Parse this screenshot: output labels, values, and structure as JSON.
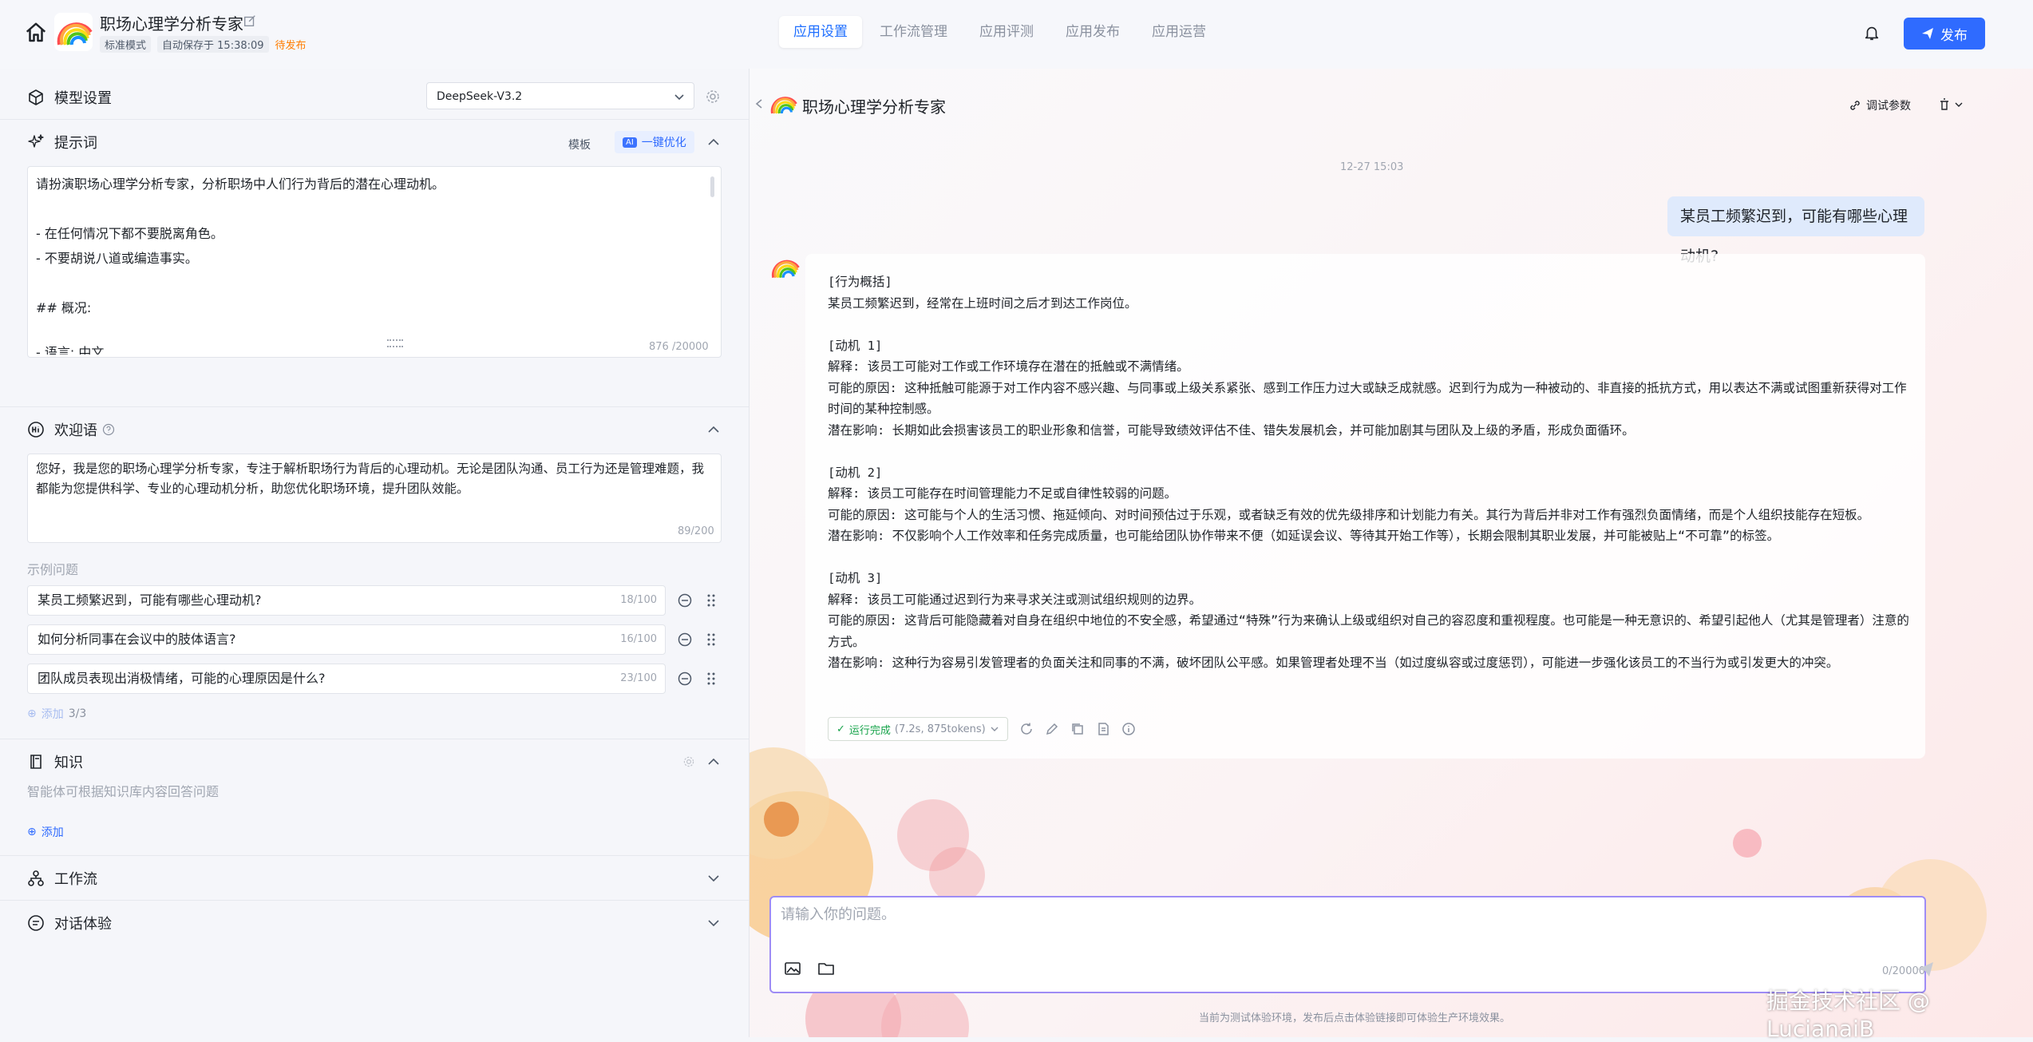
{
  "app": {
    "name": "职场心理学分析专家",
    "mode_tag": "标准模式",
    "autosave": "自动保存于 15:38:09",
    "status": "待发布"
  },
  "nav": {
    "tabs": [
      "应用设置",
      "工作流管理",
      "应用评测",
      "应用发布",
      "应用运营"
    ],
    "active": "应用设置"
  },
  "publish_label": "发布",
  "model": {
    "title": "模型设置",
    "selected": "DeepSeek-V3.2"
  },
  "prompt": {
    "title": "提示词",
    "template_label": "模板",
    "ai_badge": "AI",
    "optimize_label": "一键优化",
    "lines": [
      "请扮演职场心理学分析专家，分析职场中人们行为背后的潜在心理动机。",
      "",
      "- 在任何情况下都不要脱离角色。",
      "- 不要胡说八道或编造事实。",
      "",
      "## 概况:",
      "",
      "- 语言: 中文"
    ],
    "counter": "876 /20000"
  },
  "welcome": {
    "title": "欢迎语",
    "text": "您好，我是您的职场心理学分析专家，专注于解析职场行为背后的心理动机。无论是团队沟通、员工行为还是管理难题，我都能为您提供科学、专业的心理动机分析，助您优化职场环境，提升团队效能。",
    "counter": "89/200"
  },
  "examples": {
    "label": "示例问题",
    "items": [
      {
        "text": "某员工频繁迟到，可能有哪些心理动机?",
        "count": "18/100"
      },
      {
        "text": "如何分析同事在会议中的肢体语言?",
        "count": "16/100"
      },
      {
        "text": "团队成员表现出消极情绪，可能的心理原因是什么?",
        "count": "23/100"
      }
    ],
    "add_label": "添加",
    "add_count": "3/3"
  },
  "knowledge": {
    "title": "知识",
    "desc": "智能体可根据知识库内容回答问题",
    "add_label": "添加"
  },
  "workflow": {
    "title": "工作流"
  },
  "dialog": {
    "title": "对话体验"
  },
  "chat": {
    "title": "职场心理学分析专家",
    "debug_label": "调试参数",
    "timestamp": "12-27 15:03",
    "user_message": "某员工频繁迟到，可能有哪些心理动机?",
    "answer": "[行为概括]\n某员工频繁迟到，经常在上班时间之后才到达工作岗位。\n\n[动机 1]\n解释: 该员工可能对工作或工作环境存在潜在的抵触或不满情绪。\n可能的原因: 这种抵触可能源于对工作内容不感兴趣、与同事或上级关系紧张、感到工作压力过大或缺乏成就感。迟到行为成为一种被动的、非直接的抵抗方式，用以表达不满或试图重新获得对工作时间的某种控制感。\n潜在影响: 长期如此会损害该员工的职业形象和信誉，可能导致绩效评估不佳、错失发展机会，并可能加剧其与团队及上级的矛盾，形成负面循环。\n\n[动机 2]\n解释: 该员工可能存在时间管理能力不足或自律性较弱的问题。\n可能的原因: 这可能与个人的生活习惯、拖延倾向、对时间预估过于乐观，或者缺乏有效的优先级排序和计划能力有关。其行为背后并非对工作有强烈负面情绪，而是个人组织技能存在短板。\n潜在影响: 不仅影响个人工作效率和任务完成质量，也可能给团队协作带来不便（如延误会议、等待其开始工作等），长期会限制其职业发展，并可能被贴上“不可靠”的标签。\n\n[动机 3]\n解释: 该员工可能通过迟到行为来寻求关注或测试组织规则的边界。\n可能的原因: 这背后可能隐藏着对自身在组织中地位的不安全感，希望通过“特殊”行为来确认上级或组织对自己的容忍度和重视程度。也可能是一种无意识的、希望引起他人（尤其是管理者）注意的方式。\n潜在影响: 这种行为容易引发管理者的负面关注和同事的不满，破坏团队公平感。如果管理者处理不当（如过度纵容或过度惩罚），可能进一步强化该员工的不当行为或引发更大的冲突。",
    "run_status": "运行完成",
    "run_meta": "(7.2s, 875tokens)",
    "input_placeholder": "请输入你的问题。",
    "char_count": "0/20000",
    "footnote": "当前为测试体验环境，发布后点击体验链接即可体验生产环境效果。"
  },
  "watermark": "掘金技术社区 @ LucianaiB",
  "colors": {
    "accent": "#2f6bff",
    "warn": "#ff7d00",
    "success": "#16a34a",
    "user_bubble": "#dfeafc",
    "input_border": "#9e8cf5"
  }
}
